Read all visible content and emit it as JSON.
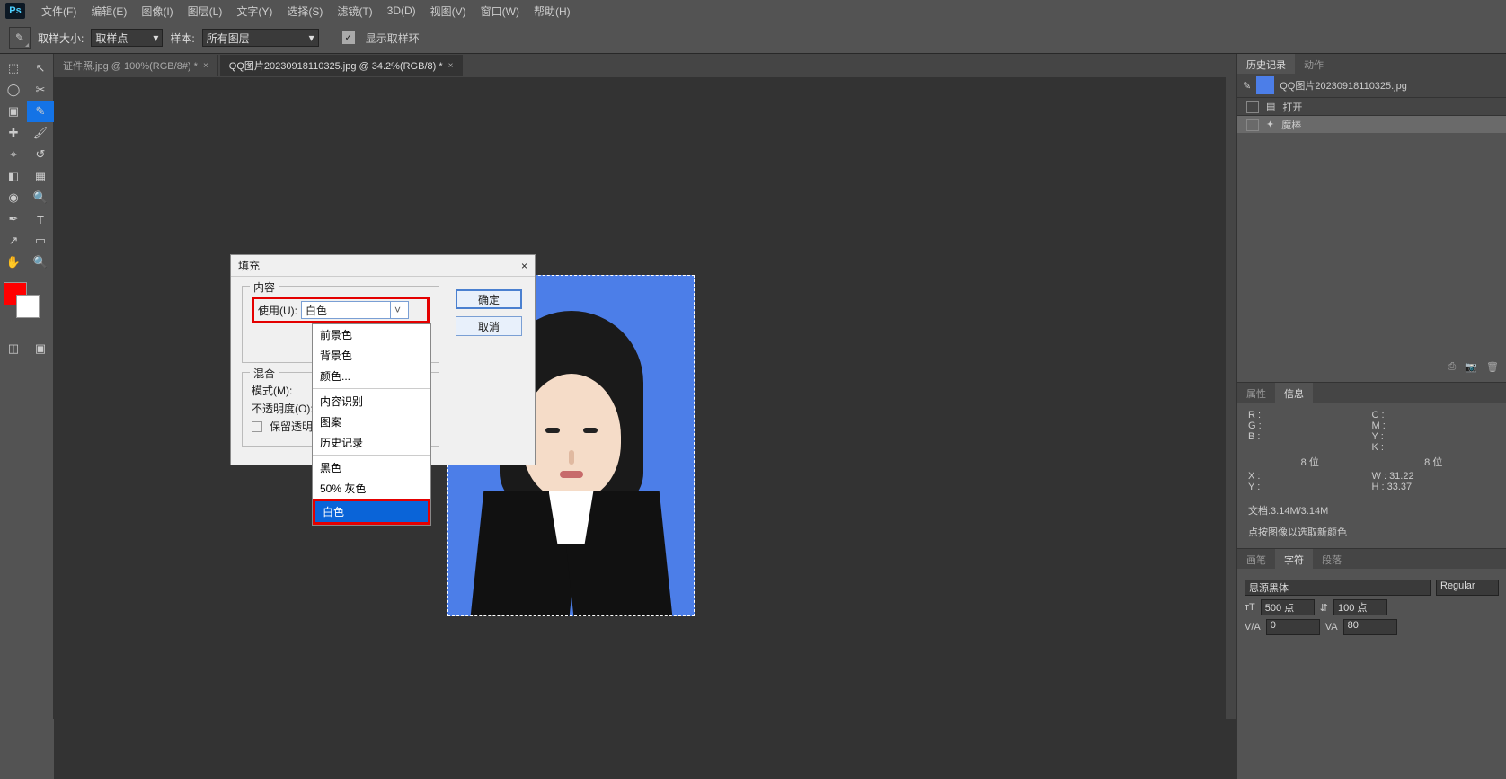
{
  "menu": {
    "items": [
      "文件(F)",
      "编辑(E)",
      "图像(I)",
      "图层(L)",
      "文字(Y)",
      "选择(S)",
      "滤镜(T)",
      "3D(D)",
      "视图(V)",
      "窗口(W)",
      "帮助(H)"
    ]
  },
  "optbar": {
    "sample_size_label": "取样大小:",
    "sample_size_value": "取样点",
    "sample_label": "样本:",
    "sample_value": "所有图层",
    "show_ring": "显示取样环"
  },
  "tabs": [
    {
      "label": "证件照.jpg @ 100%(RGB/8#) *",
      "active": false
    },
    {
      "label": "QQ图片20230918110325.jpg @ 34.2%(RGB/8) *",
      "active": true
    }
  ],
  "dialog": {
    "title": "填充",
    "close": "×",
    "groups": {
      "content": "内容",
      "blend": "混合"
    },
    "use_label": "使用(U):",
    "use_value": "白色",
    "mode_label": "模式(M):",
    "opacity_label": "不透明度(O):",
    "preserve_trans": "保留透明区域",
    "ok": "确定",
    "cancel": "取消",
    "dropdown": [
      "前景色",
      "背景色",
      "颜色...",
      "内容识别",
      "图案",
      "历史记录",
      "黑色",
      "50% 灰色",
      "白色"
    ]
  },
  "history": {
    "tabs": [
      "历史记录",
      "动作"
    ],
    "doc": "QQ图片20230918110325.jpg",
    "items": [
      {
        "label": "打开",
        "sel": false
      },
      {
        "label": "魔棒",
        "sel": true
      }
    ]
  },
  "props": {
    "tabs": [
      "属性",
      "信息"
    ],
    "rgb": {
      "r": "R :",
      "g": "G :",
      "b": "B :"
    },
    "cmy": {
      "c": "C :",
      "m": "M :",
      "y": "Y :",
      "k": "K :"
    },
    "bits": "8 位",
    "xy": {
      "x": "X :",
      "y": "Y :"
    },
    "wh": {
      "w": "W :",
      "h": "H :",
      "wv": "31.22",
      "hv": "33.37"
    },
    "doc": "文档:3.14M/3.14M",
    "hint": "点按图像以选取新颜色"
  },
  "brush": {
    "tabs": [
      "画笔",
      "字符",
      "段落"
    ],
    "font": "思源黑体",
    "style": "Regular",
    "size": "500 点",
    "leading": "100 点",
    "tracking": "0",
    "va": "80"
  }
}
